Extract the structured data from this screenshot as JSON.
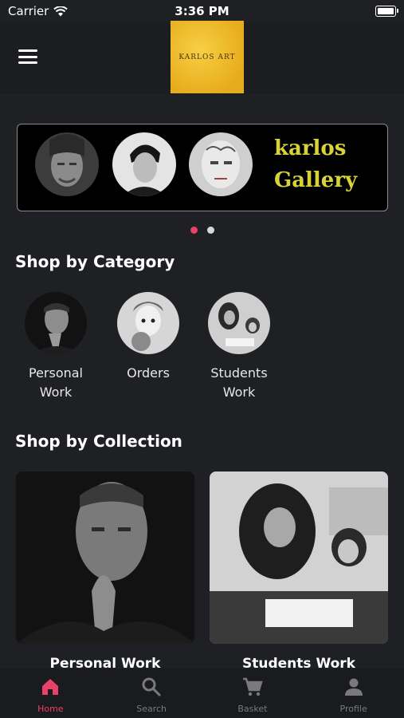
{
  "status": {
    "carrier": "Carrier",
    "time": "3:36 PM"
  },
  "header": {
    "logo_text": "KARLOS ART"
  },
  "banner": {
    "line1": "karlos",
    "line2": "Gallery"
  },
  "sections": {
    "category_title": "Shop by Category",
    "collection_title": "Shop by Collection"
  },
  "categories": [
    {
      "label": "Personal\nWork"
    },
    {
      "label": "Orders"
    },
    {
      "label": "Students\nWork"
    }
  ],
  "collections": [
    {
      "label": "Personal Work"
    },
    {
      "label": "Students Work"
    }
  ],
  "tabs": [
    {
      "label": "Home",
      "icon": "home-icon",
      "active": true
    },
    {
      "label": "Search",
      "icon": "search-icon",
      "active": false
    },
    {
      "label": "Basket",
      "icon": "cart-icon",
      "active": false
    },
    {
      "label": "Profile",
      "icon": "person-icon",
      "active": false
    }
  ],
  "colors": {
    "accent": "#e8416a",
    "banner_text": "#d9d33a",
    "logo_bg": "#f0c030",
    "background": "#1f2023"
  }
}
